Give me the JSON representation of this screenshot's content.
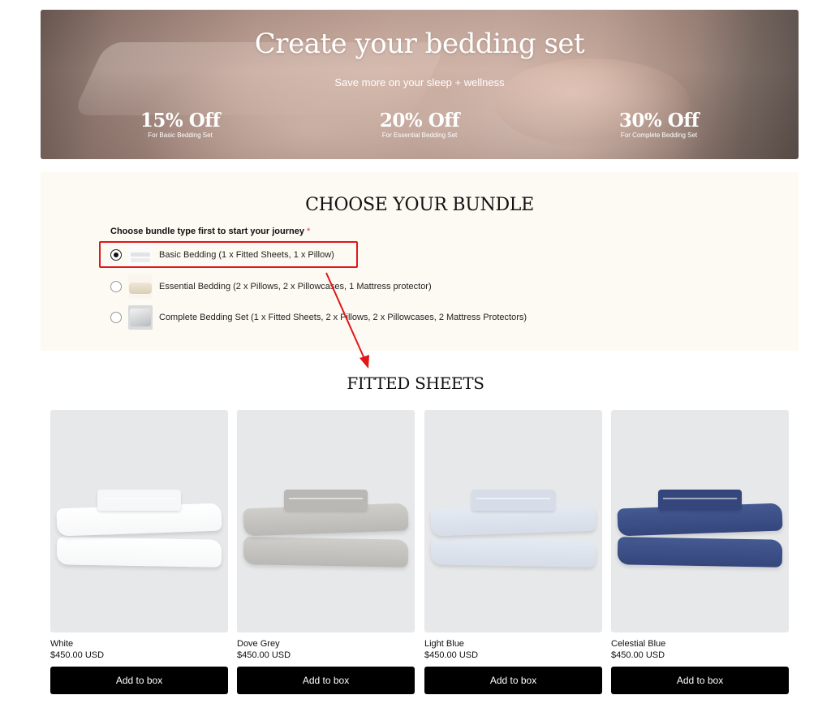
{
  "hero": {
    "title": "Create your bedding set",
    "subtitle": "Save more on your sleep + wellness",
    "offers": [
      {
        "value": "15% Off",
        "label": "For Basic Bedding Set"
      },
      {
        "value": "20% Off",
        "label": "For Essential Bedding Set"
      },
      {
        "value": "30% Off",
        "label": "For Complete Bedding Set"
      }
    ]
  },
  "bundle": {
    "heading": "CHOOSE YOUR BUNDLE",
    "prompt": "Choose bundle type first to start your journey",
    "required_mark": "*",
    "options": [
      {
        "label": "Basic Bedding (1 x Fitted Sheets, 1 x Pillow)",
        "selected": true
      },
      {
        "label": "Essential Bedding (2 x Pillows, 2 x Pillowcases, 1 Mattress protector)",
        "selected": false
      },
      {
        "label": "Complete Bedding Set (1 x Fitted Sheets, 2 x Pillows, 2 x Pillowcases, 2 Mattress Protectors)",
        "selected": false
      }
    ]
  },
  "annotation": {
    "highlight_color": "#e0161a"
  },
  "fitted_sheets": {
    "heading": "FITTED SHEETS",
    "products": [
      {
        "name": "White",
        "price": "$450.00 USD",
        "button": "Add to box",
        "color": "#f6f7f8",
        "shade": "#ffffff"
      },
      {
        "name": "Dove Grey",
        "price": "$450.00 USD",
        "button": "Add to box",
        "color": "#b9b8b4",
        "shade": "#cfcecb"
      },
      {
        "name": "Light Blue",
        "price": "$450.00 USD",
        "button": "Add to box",
        "color": "#d6dde8",
        "shade": "#e5eaf2"
      },
      {
        "name": "Celestial Blue",
        "price": "$450.00 USD",
        "button": "Add to box",
        "color": "#34467c",
        "shade": "#455a92"
      }
    ]
  }
}
